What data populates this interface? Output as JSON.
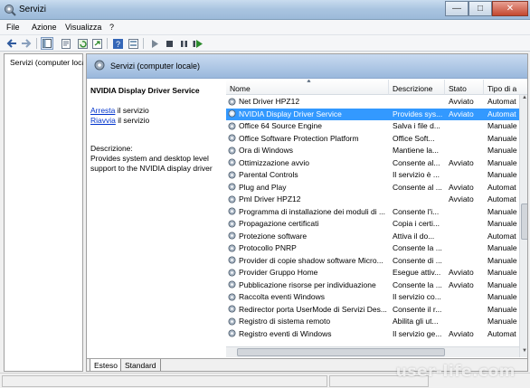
{
  "window": {
    "title": "Servizi"
  },
  "menubar": [
    "File",
    "Azione",
    "Visualizza",
    "?"
  ],
  "toolbar": [
    "back-icon",
    "forward-icon",
    "console-tree-icon",
    "properties-icon",
    "refresh-icon",
    "export-icon",
    "help-icon",
    "view-icon",
    "play-icon",
    "stop-icon",
    "pause-icon",
    "restart-icon"
  ],
  "tree": {
    "root_label": "Servizi (computer locale)"
  },
  "main_header": {
    "title": "Servizi (computer locale)"
  },
  "details": {
    "service_name": "NVIDIA Display Driver Service",
    "stop_link": "Arresta",
    "stop_suffix": " il servizio",
    "restart_link": "Riavvia",
    "restart_suffix": " il servizio",
    "description_label": "Descrizione:",
    "description_text": "Provides system and desktop level support to the NVIDIA display driver"
  },
  "columns": {
    "name": "Nome",
    "description": "Descrizione",
    "state": "Stato",
    "startup": "Tipo di a"
  },
  "services": [
    {
      "name": "Net Driver HPZ12",
      "description": "",
      "state": "Avviato",
      "startup": "Automat"
    },
    {
      "name": "NVIDIA Display Driver Service",
      "description": "Provides sys...",
      "state": "Avviato",
      "startup": "Automat"
    },
    {
      "name": "Office 64 Source Engine",
      "description": "Salva i file d...",
      "state": "",
      "startup": "Manuale"
    },
    {
      "name": "Office Software Protection Platform",
      "description": "Office Soft...",
      "state": "",
      "startup": "Manuale"
    },
    {
      "name": "Ora di Windows",
      "description": "Mantiene la...",
      "state": "",
      "startup": "Manuale"
    },
    {
      "name": "Ottimizzazione avvio",
      "description": "Consente al...",
      "state": "Avviato",
      "startup": "Manuale"
    },
    {
      "name": "Parental Controls",
      "description": "Il servizio è ...",
      "state": "",
      "startup": "Manuale"
    },
    {
      "name": "Plug and Play",
      "description": "Consente al ...",
      "state": "Avviato",
      "startup": "Automat"
    },
    {
      "name": "Pml Driver HPZ12",
      "description": "",
      "state": "Avviato",
      "startup": "Automat"
    },
    {
      "name": "Programma di installazione dei moduli di ...",
      "description": "Consente l'i...",
      "state": "",
      "startup": "Manuale"
    },
    {
      "name": "Propagazione certificati",
      "description": "Copia i certi...",
      "state": "",
      "startup": "Manuale"
    },
    {
      "name": "Protezione software",
      "description": "Attiva il do...",
      "state": "",
      "startup": "Automat"
    },
    {
      "name": "Protocollo PNRP",
      "description": "Consente la ...",
      "state": "",
      "startup": "Manuale"
    },
    {
      "name": "Provider di copie shadow software Micro...",
      "description": "Consente di ...",
      "state": "",
      "startup": "Manuale"
    },
    {
      "name": "Provider Gruppo Home",
      "description": "Esegue attiv...",
      "state": "Avviato",
      "startup": "Manuale"
    },
    {
      "name": "Pubblicazione risorse per individuazione",
      "description": "Consente la ...",
      "state": "Avviato",
      "startup": "Manuale"
    },
    {
      "name": "Raccolta eventi Windows",
      "description": "Il servizio co...",
      "state": "",
      "startup": "Manuale"
    },
    {
      "name": "Redirector porta UserMode di Servizi Des...",
      "description": "Consente il r...",
      "state": "",
      "startup": "Manuale"
    },
    {
      "name": "Registro di sistema remoto",
      "description": "Abilita gli ut...",
      "state": "",
      "startup": "Manuale"
    },
    {
      "name": "Registro eventi di Windows",
      "description": "Il servizio ge...",
      "state": "Avviato",
      "startup": "Automat"
    }
  ],
  "tabs": [
    "Esteso",
    "Standard"
  ],
  "watermark": "user-life.com",
  "colors": {
    "selection": "#3399ff",
    "link": "#0033cc",
    "header_gradient_top": "#c8daf0",
    "header_gradient_bottom": "#9ab8dc"
  }
}
